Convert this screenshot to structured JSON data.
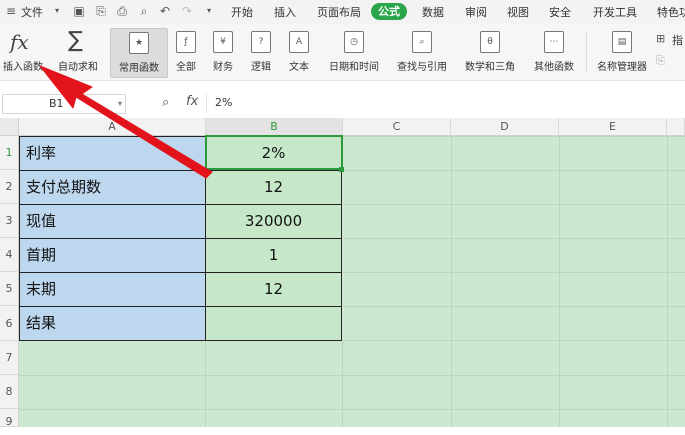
{
  "menubar": {
    "file_label": "文件",
    "tabs": [
      "开始",
      "插入",
      "页面布局",
      "公式",
      "数据",
      "审阅",
      "视图",
      "安全",
      "开发工具",
      "特色功"
    ],
    "active_tab": "公式"
  },
  "ribbon": {
    "insert_function": "插入函数",
    "autosum": "自动求和",
    "common_functions": "常用函数",
    "all": "全部",
    "finance": "财务",
    "logic": "逻辑",
    "text": "文本",
    "datetime": "日期和时间",
    "lookup": "查找与引用",
    "math": "数学和三角",
    "other": "其他函数",
    "name_manager": "名称管理器",
    "right_top": "指",
    "icon_fx": "fx",
    "icon_sum": "∑"
  },
  "formula_bar": {
    "name_box": "B1",
    "fx_label": "fx",
    "value": "2%"
  },
  "sheet": {
    "columns": [
      "A",
      "B",
      "C",
      "D",
      "E"
    ],
    "row_numbers": [
      "1",
      "2",
      "3",
      "4",
      "5",
      "6",
      "7",
      "8",
      "9"
    ],
    "rows": [
      {
        "label": "利率",
        "value": "2%"
      },
      {
        "label": "支付总期数",
        "value": "12"
      },
      {
        "label": "现值",
        "value": "320000"
      },
      {
        "label": "首期",
        "value": "1"
      },
      {
        "label": "末期",
        "value": "12"
      },
      {
        "label": "结果",
        "value": ""
      }
    ]
  },
  "colors": {
    "accent": "#2aa64a",
    "arrow": "#e3131b",
    "label_fill": "#bdd7ee",
    "value_fill": "#c6e8c9"
  }
}
